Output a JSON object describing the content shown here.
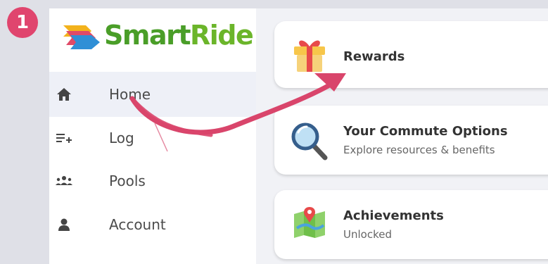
{
  "step_badge": "1",
  "logo": {
    "smart": "Smart",
    "ride": "Ride"
  },
  "nav": [
    {
      "label": "Home",
      "icon": "home-icon",
      "active": true
    },
    {
      "label": "Log",
      "icon": "log-add-icon",
      "active": false
    },
    {
      "label": "Pools",
      "icon": "group-icon",
      "active": false
    },
    {
      "label": "Account",
      "icon": "person-icon",
      "active": false
    }
  ],
  "cards": [
    {
      "title": "Rewards",
      "subtitle": "",
      "icon": "gift-icon"
    },
    {
      "title": "Your Commute Options",
      "subtitle": "Explore resources & benefits",
      "icon": "magnifier-icon"
    },
    {
      "title": "Achievements",
      "subtitle": "Unlocked",
      "icon": "map-pin-icon"
    }
  ],
  "colors": {
    "accent": "#e0456e",
    "brand_green": "#4a9e28",
    "background": "#dfe0e7"
  }
}
